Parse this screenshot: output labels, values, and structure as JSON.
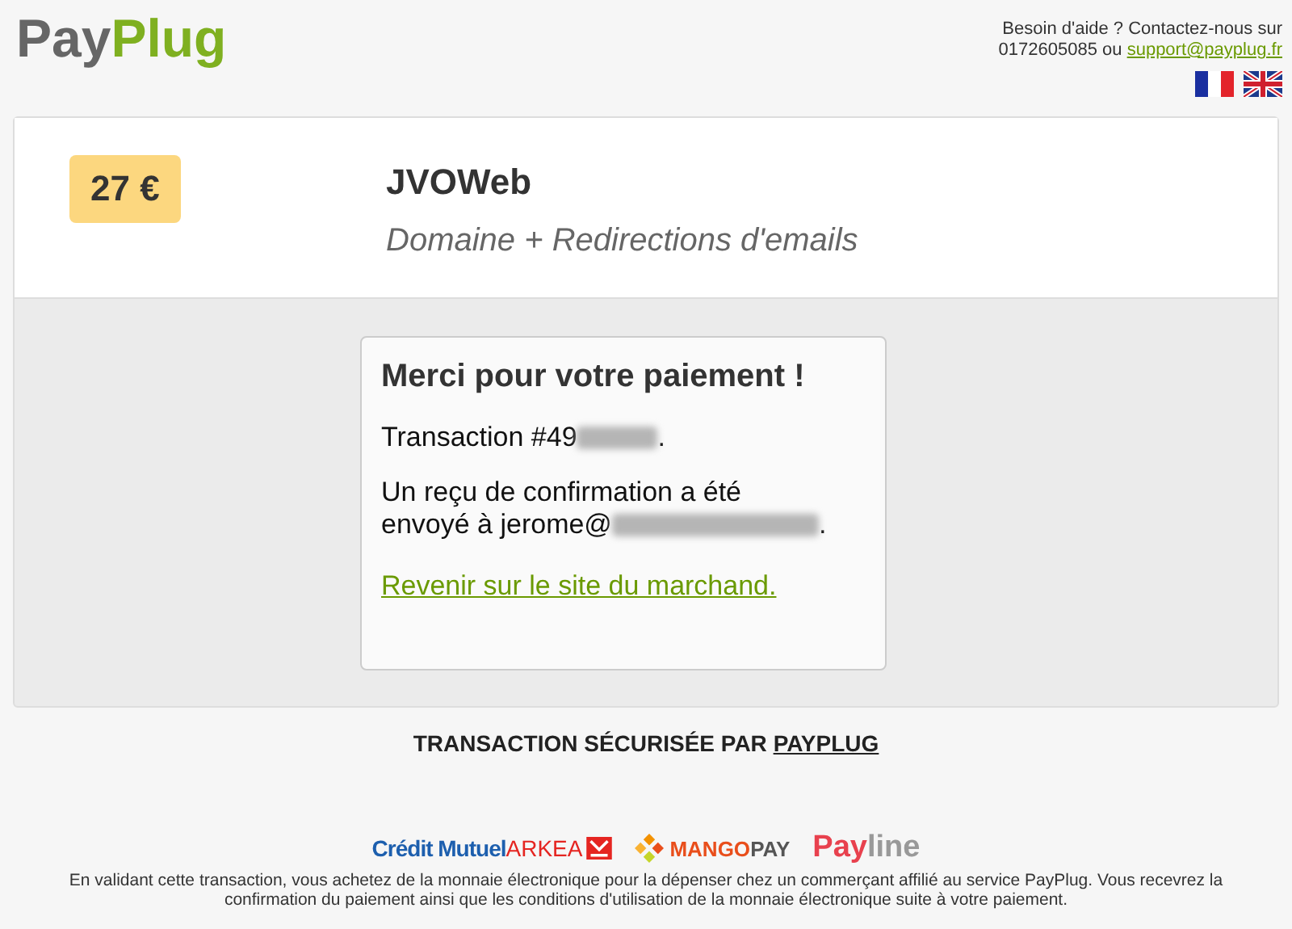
{
  "logo": {
    "part_1": "Pay",
    "part_2": "Plug"
  },
  "help": {
    "text": "Besoin d'aide ? Contactez-nous sur 0172605085 ou",
    "email": "support@payplug.fr"
  },
  "languages": [
    {
      "kind": "fr"
    },
    {
      "kind": "en"
    }
  ],
  "order": {
    "price": "27 €",
    "merchant": "JVOWeb",
    "description": "Domaine + Redirections d'emails"
  },
  "confirmation": {
    "title": "Merci pour votre paiement !",
    "transaction_prefix": "Transaction #49",
    "transaction_suffix": ".",
    "receipt_line_1": "Un reçu de confirmation a été",
    "receipt_prefix": "envoyé à jerome@",
    "receipt_suffix": ".",
    "link": "Revenir sur le site du marchand."
  },
  "secured": {
    "text": "TRANSACTION SÉCURISÉE PAR",
    "brand": "PAYPLUG"
  },
  "partners": [
    {
      "kind": "creditmutuel",
      "part_1": "Crédit Mutuel",
      "part_2": "ARKEA"
    },
    {
      "kind": "mangopay",
      "part_1": "MANGO",
      "part_2": "PAY"
    },
    {
      "kind": "payline",
      "part_1": "Pay",
      "part_2": "line"
    }
  ],
  "disclaimer": "En validant cette transaction, vous achetez de la monnaie électronique pour la dépenser chez un commerçant affilié au service PayPlug. Vous recevrez la confirmation du paiement ainsi que les conditions d'utilisation de la monnaie électronique suite à votre paiement."
}
